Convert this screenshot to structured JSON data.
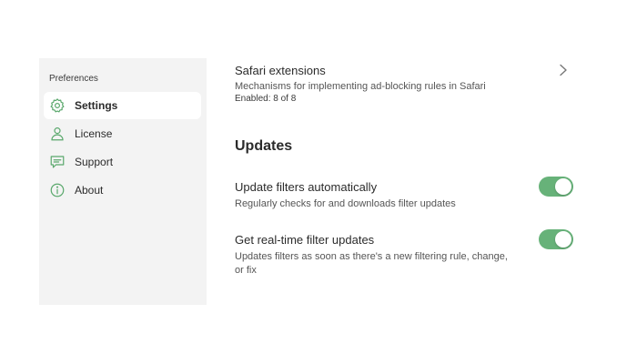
{
  "sidebar": {
    "header": "Preferences",
    "items": [
      {
        "label": "Settings",
        "icon": "gear-icon",
        "active": true
      },
      {
        "label": "License",
        "icon": "person-icon",
        "active": false
      },
      {
        "label": "Support",
        "icon": "chat-icon",
        "active": false
      },
      {
        "label": "About",
        "icon": "info-icon",
        "active": false
      }
    ]
  },
  "extensions": {
    "title": "Safari extensions",
    "description": "Mechanisms for implementing ad-blocking rules in Safari",
    "status": "Enabled: 8 of 8"
  },
  "updates": {
    "title": "Updates",
    "settings": [
      {
        "title": "Update filters automatically",
        "description": "Regularly checks for and downloads filter updates",
        "enabled": true
      },
      {
        "title": "Get real-time filter updates",
        "description": "Updates filters as soon as there's a new filtering rule, change, or fix",
        "enabled": true
      }
    ]
  },
  "colors": {
    "accent": "#67b279",
    "sidebar_bg": "#f3f3f3",
    "icon_green": "#5aa86c"
  }
}
